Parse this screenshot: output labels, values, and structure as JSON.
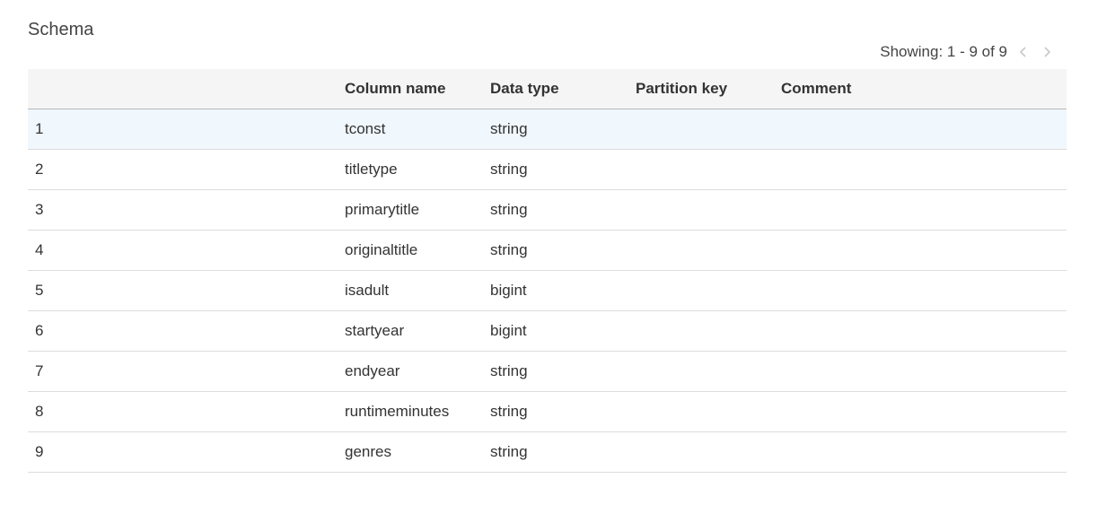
{
  "title": "Schema",
  "pagination": {
    "text": "Showing: 1 - 9 of 9",
    "prev_icon": "chevron-left-icon",
    "next_icon": "chevron-right-icon"
  },
  "table": {
    "headers": [
      "",
      "Column name",
      "Data type",
      "Partition key",
      "Comment"
    ],
    "rows": [
      {
        "index": "1",
        "name": "tconst",
        "type": "string",
        "partition": "",
        "comment": "",
        "selected": true
      },
      {
        "index": "2",
        "name": "titletype",
        "type": "string",
        "partition": "",
        "comment": ""
      },
      {
        "index": "3",
        "name": "primarytitle",
        "type": "string",
        "partition": "",
        "comment": ""
      },
      {
        "index": "4",
        "name": "originaltitle",
        "type": "string",
        "partition": "",
        "comment": ""
      },
      {
        "index": "5",
        "name": "isadult",
        "type": "bigint",
        "partition": "",
        "comment": ""
      },
      {
        "index": "6",
        "name": "startyear",
        "type": "bigint",
        "partition": "",
        "comment": ""
      },
      {
        "index": "7",
        "name": "endyear",
        "type": "string",
        "partition": "",
        "comment": ""
      },
      {
        "index": "8",
        "name": "runtimeminutes",
        "type": "string",
        "partition": "",
        "comment": ""
      },
      {
        "index": "9",
        "name": "genres",
        "type": "string",
        "partition": "",
        "comment": ""
      }
    ]
  },
  "colors": {
    "header_bg": "#f5f5f5",
    "selected_row_bg": "#f0f7fd",
    "arrow_disabled": "#c8c8c8"
  }
}
